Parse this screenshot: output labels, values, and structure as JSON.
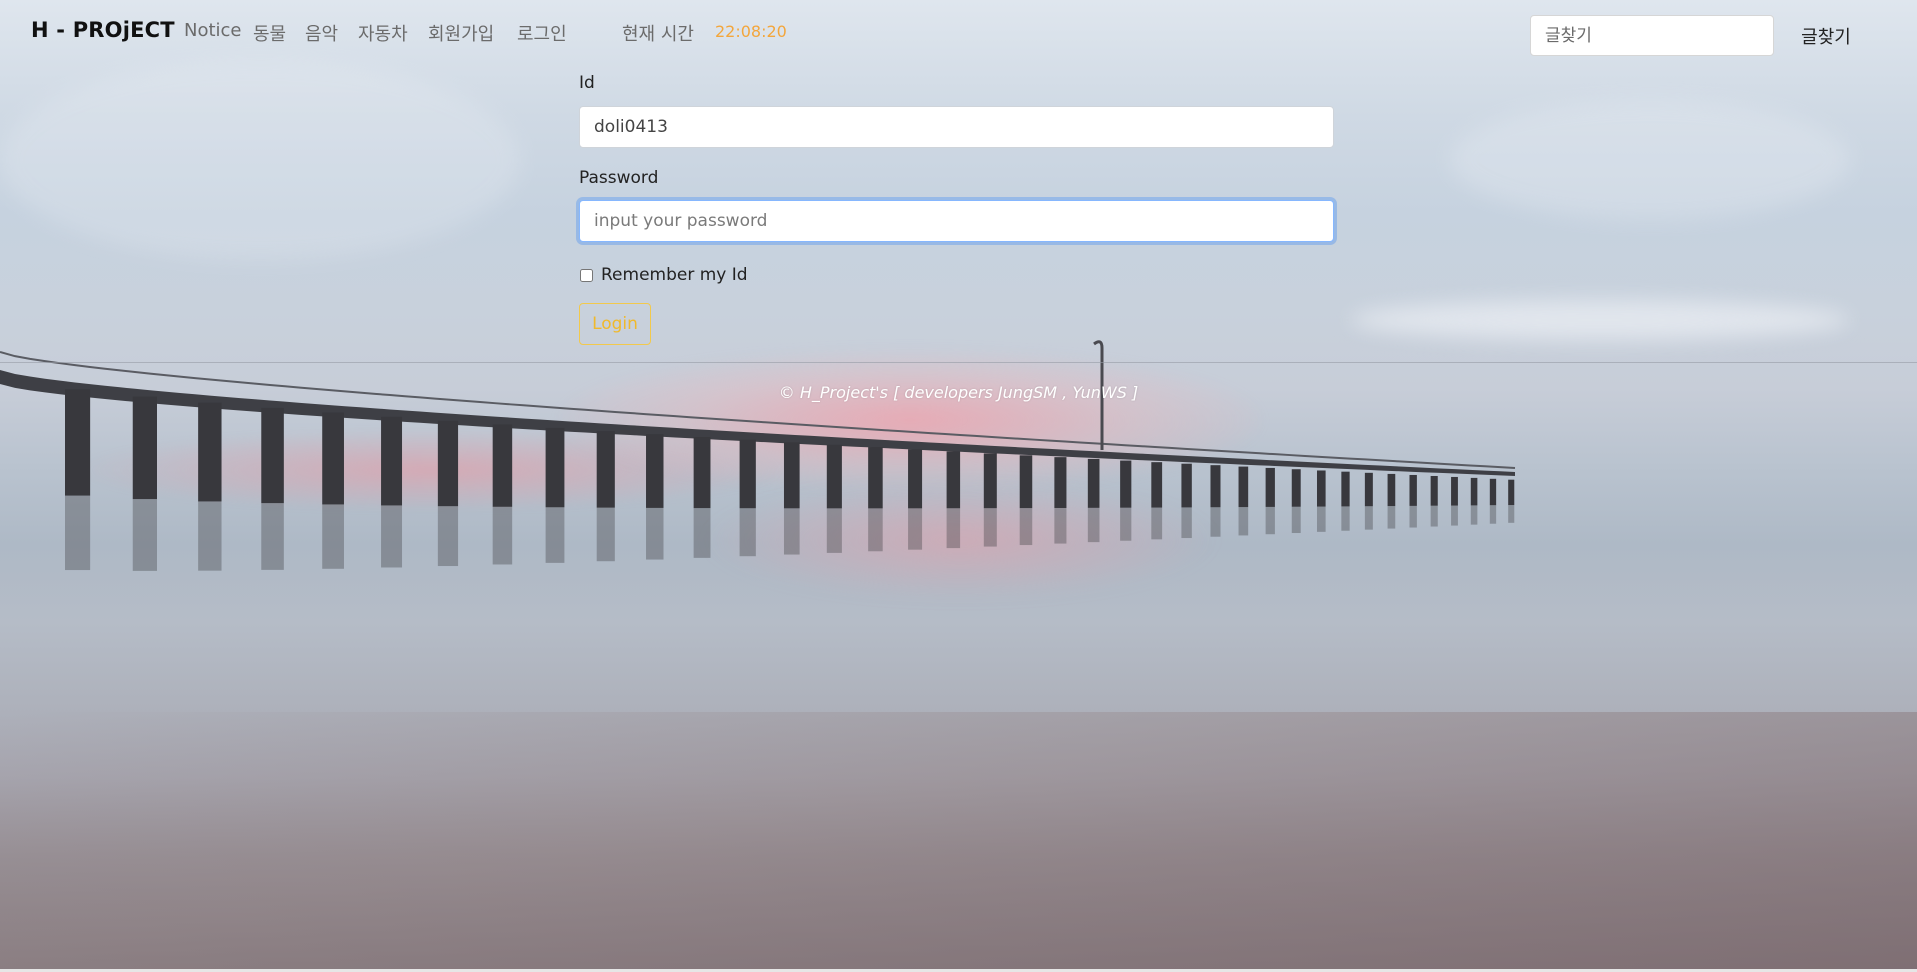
{
  "navbar": {
    "brand": "H - PROjECT",
    "links": [
      "Notice",
      "동물",
      "음악",
      "자동차",
      "회원가입",
      "로그인"
    ],
    "clock_label": "현재 시간",
    "clock_value": "22:08:20",
    "search_placeholder": "글찾기",
    "search_button_label": "글찾기"
  },
  "login_form": {
    "id_label": "Id",
    "id_value": "doli0413",
    "password_label": "Password",
    "password_placeholder": "input your password",
    "remember_label": "Remember my Id",
    "remember_checked": false,
    "login_button_label": "Login"
  },
  "footer": {
    "text": "© H_Project's [ developers JungSM , YunWS ]"
  },
  "colors": {
    "clock_value": "#f3a63c",
    "login_button": "#f0b92c",
    "input_focus": "#86b7fe"
  },
  "background": {
    "description_icon": "pier-at-dusk-photo"
  }
}
